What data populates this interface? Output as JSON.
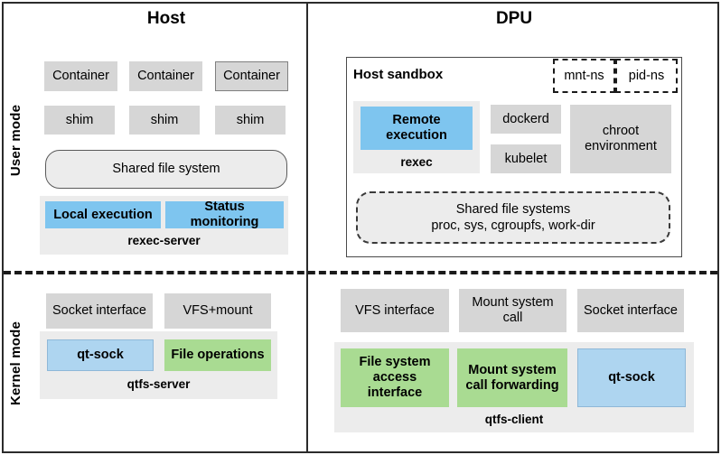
{
  "diagram": {
    "title_left": "Host",
    "title_right": "DPU",
    "side_labels": {
      "user_mode": "User mode",
      "kernel_mode": "Kernel mode"
    }
  },
  "colors": {
    "blue_strong": "#7ec5ef",
    "blue_light": "#aed5f0",
    "green": "#a9db92",
    "gray": "#d6d6d6",
    "panel_gray": "#ececec",
    "frame": "#2b2b2b"
  },
  "host": {
    "user_mode": {
      "containers": [
        "Container",
        "Container",
        "Container"
      ],
      "shims": [
        "shim",
        "shim",
        "shim"
      ],
      "shared_file_system": "Shared file system",
      "rexec_server": {
        "caption": "rexec-server",
        "modules": [
          "Local execution",
          "Status monitoring"
        ]
      }
    },
    "kernel_mode": {
      "interfaces": [
        "Socket interface",
        "VFS+mount"
      ],
      "qtfs_server": {
        "caption": "qtfs-server",
        "modules": [
          "qt-sock",
          "File operations"
        ]
      }
    }
  },
  "dpu": {
    "user_mode": {
      "sandbox_title": "Host sandbox",
      "namespaces": [
        "mnt-ns",
        "pid-ns"
      ],
      "rexec": {
        "caption": "rexec",
        "module": "Remote execution"
      },
      "daemons": [
        "dockerd",
        "kubelet"
      ],
      "chroot": "chroot environment",
      "shared_file_systems": {
        "line1": "Shared file systems",
        "line2": "proc, sys, cgroupfs, work-dir"
      }
    },
    "kernel_mode": {
      "interfaces": [
        "VFS interface",
        "Mount system call",
        "Socket interface"
      ],
      "qtfs_client": {
        "caption": "qtfs-client",
        "modules": [
          "File system access interface",
          "Mount system call forwarding",
          "qt-sock"
        ]
      }
    }
  }
}
